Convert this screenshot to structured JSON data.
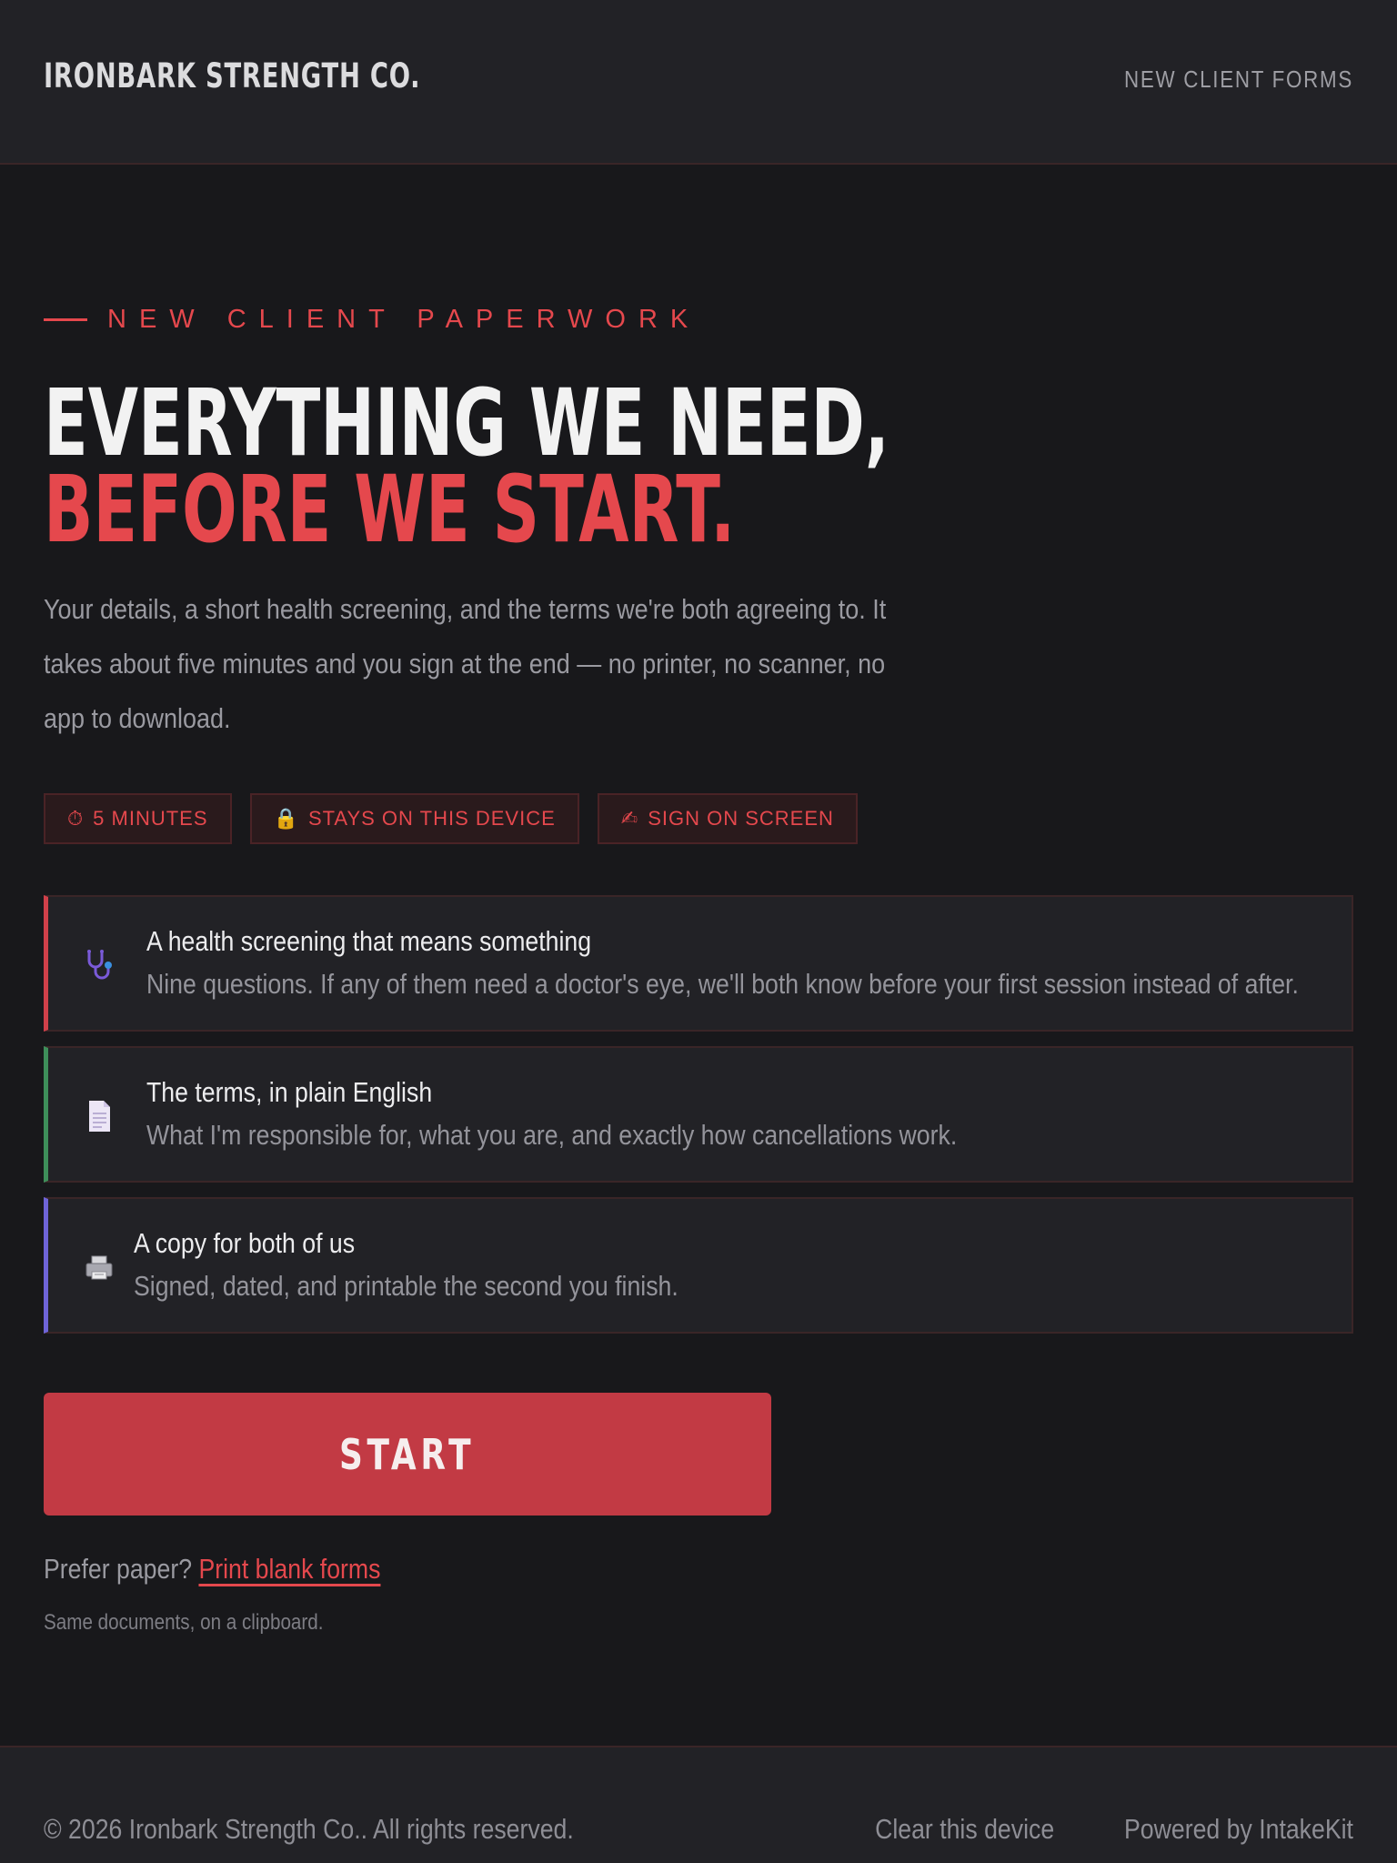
{
  "header": {
    "brand": "IRONBARK STRENGTH CO.",
    "nav_link": "NEW CLIENT FORMS"
  },
  "hero": {
    "eyebrow": "NEW CLIENT PAPERWORK",
    "title_line1": "EVERYTHING WE NEED,",
    "title_line2": "BEFORE WE START.",
    "lead": "Your details, a short health screening, and the terms we're both agreeing to. It takes about five minutes and you sign at the end — no printer, no scanner, no app to download."
  },
  "pills": [
    {
      "icon": "stopwatch-icon",
      "glyph": "⏱",
      "label": "5 MINUTES"
    },
    {
      "icon": "lock-icon",
      "glyph": "🔒",
      "label": "STAYS ON THIS DEVICE"
    },
    {
      "icon": "writing-hand-icon",
      "glyph": "✍",
      "label": "SIGN ON SCREEN"
    }
  ],
  "features": [
    {
      "icon": "stethoscope-icon",
      "title": "A health screening that means something",
      "desc": "Nine questions. If any of them need a doctor's eye, we'll both know before your first session instead of after."
    },
    {
      "icon": "document-icon",
      "title": "The terms, in plain English",
      "desc": "What I'm responsible for, what you are, and exactly how cancellations work."
    },
    {
      "icon": "printer-icon",
      "title": "A copy for both of us",
      "desc": "Signed, dated, and printable the second you finish."
    }
  ],
  "cta": {
    "start_label": "START",
    "paper_prefix": "Prefer paper?",
    "paper_link": "Print blank forms",
    "paper_sub": "Same documents, on a clipboard."
  },
  "footer": {
    "copyright": "© 2026 Ironbark Strength Co.. All rights reserved.",
    "clear_link": "Clear this device",
    "powered": "Powered by IntakeKit"
  },
  "colors": {
    "background": "#18181b",
    "panel": "#222226",
    "accent": "#e5484d",
    "button": "#c23a44",
    "card1_border": "#d0404a",
    "card2_border": "#3e8e5a",
    "card3_border": "#6e64d8"
  }
}
